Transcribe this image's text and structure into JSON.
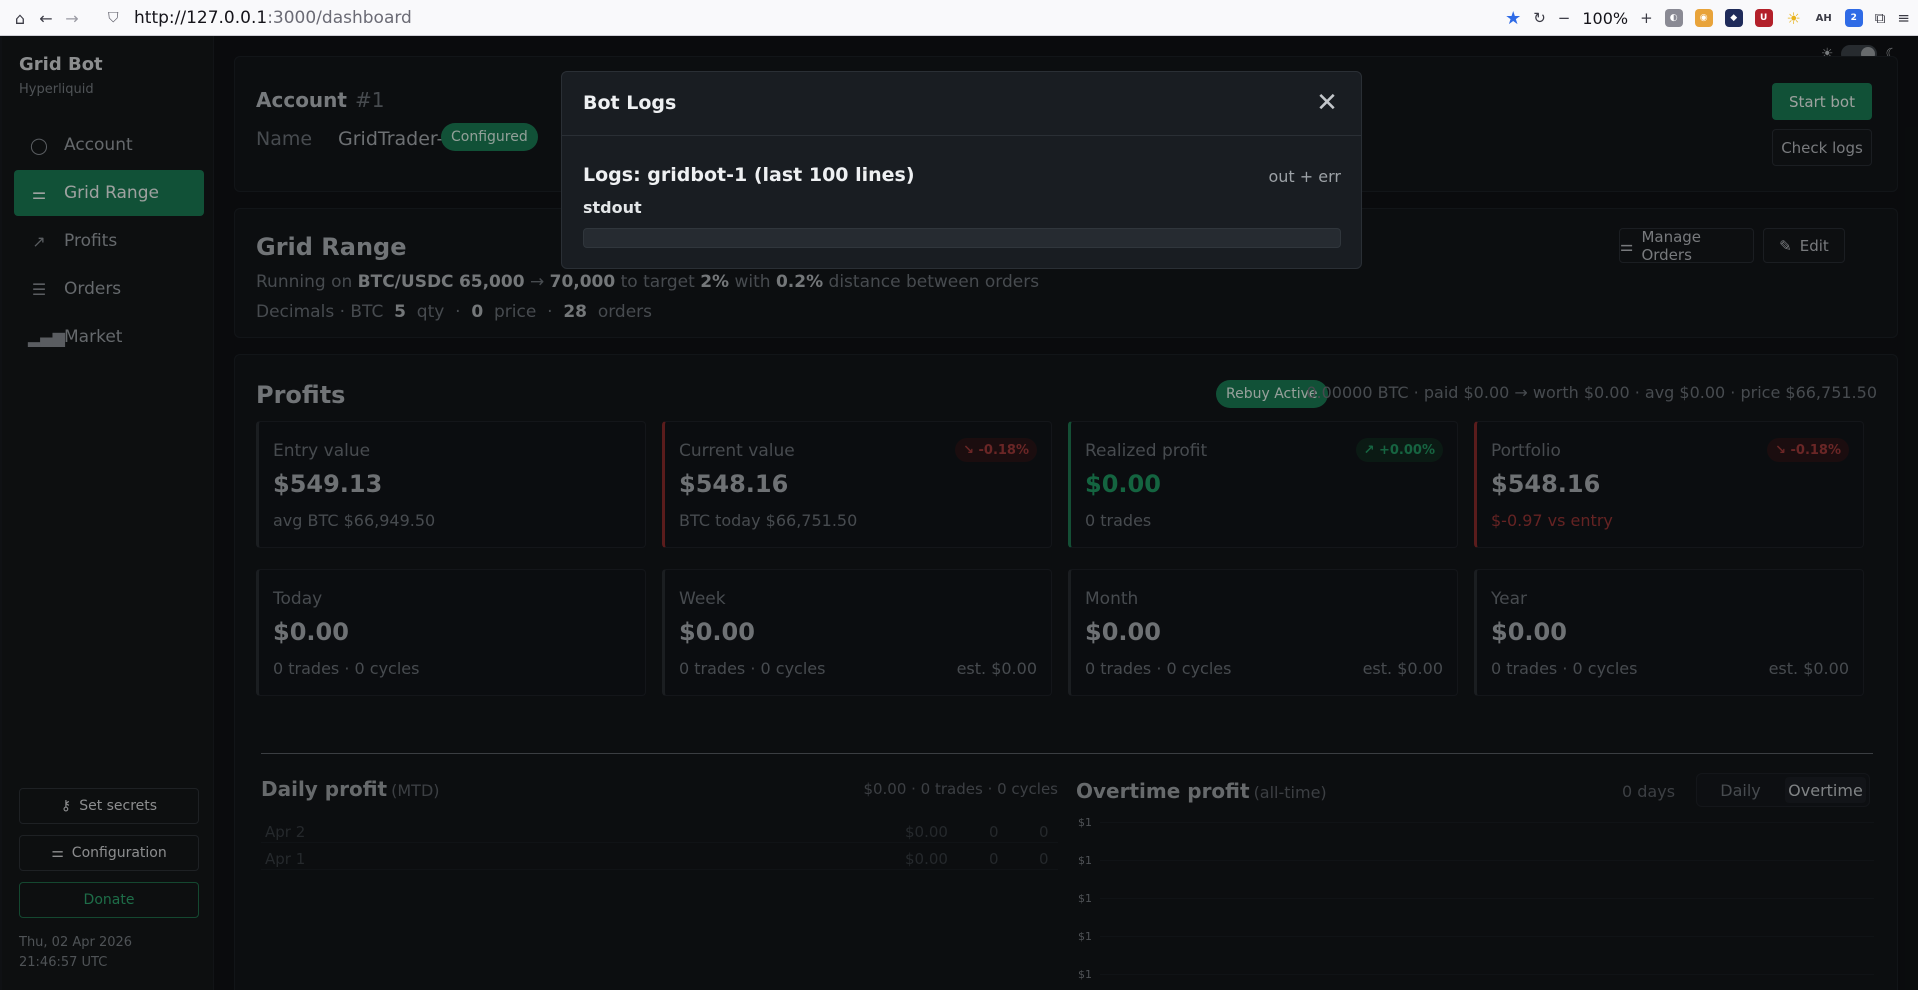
{
  "browser": {
    "url_host": "http://127.0.0.1",
    "url_rest": ":3000/dashboard",
    "zoom": "100%"
  },
  "sidebar": {
    "brand": "Grid Bot",
    "subtitle": "Hyperliquid",
    "items": [
      {
        "label": "Account",
        "icon": "user-circle-icon",
        "active": false
      },
      {
        "label": "Grid Range",
        "icon": "sliders-icon",
        "active": true
      },
      {
        "label": "Profits",
        "icon": "trend-chart-icon",
        "active": false
      },
      {
        "label": "Orders",
        "icon": "list-icon",
        "active": false
      },
      {
        "label": "Market",
        "icon": "bar-chart-icon",
        "active": false
      }
    ],
    "set_secrets": "Set secrets",
    "configuration": "Configuration",
    "donate": "Donate",
    "timestamp": "Thu, 02 Apr 2026 21:46:57 UTC"
  },
  "account": {
    "title": "Account",
    "number": "#1",
    "name_label": "Name",
    "name_value": "GridTrader-1",
    "status_badge": "Configured",
    "start_bot": "Start bot",
    "check_logs": "Check logs"
  },
  "grid_range": {
    "title": "Grid Range",
    "manage_orders": "Manage Orders",
    "edit": "Edit",
    "running_on": "Running on",
    "pair": "BTC/USDC",
    "low": "65,000",
    "arrow": "→",
    "high": "70,000",
    "to_target": "to target",
    "target": "2%",
    "with": "with",
    "distance": "0.2%",
    "distance_text": "distance between orders",
    "decimals_label": "Decimals · BTC",
    "qty": "5",
    "qty_label": "qty",
    "price": "0",
    "price_label": "price",
    "orders": "28",
    "orders_label": "orders",
    "sep": "·"
  },
  "profits": {
    "title": "Profits",
    "rebuy": "Rebuy Active",
    "summary": "0.00000 BTC · paid $0.00 → worth $0.00 · avg $0.00 · price $66,751.50",
    "cards": [
      {
        "label": "Entry value",
        "value": "$549.13",
        "sub": "avg BTC $66,949.50",
        "pill": "",
        "accent": "neutral"
      },
      {
        "label": "Current value",
        "value": "$548.16",
        "sub": "BTC today $66,751.50",
        "pill": "↘ -0.18%",
        "accent": "red"
      },
      {
        "label": "Realized profit",
        "value": "$0.00",
        "sub": "0 trades",
        "pill": "↗ +0.00%",
        "accent": "green"
      },
      {
        "label": "Portfolio",
        "value": "$548.16",
        "sub": "$-0.97 vs entry",
        "pill": "↘ -0.18%",
        "accent": "red"
      }
    ],
    "periods": [
      {
        "label": "Today",
        "value": "$0.00",
        "sub": "0 trades · 0 cycles",
        "est": ""
      },
      {
        "label": "Week",
        "value": "$0.00",
        "sub": "0 trades · 0 cycles",
        "est": "est. $0.00"
      },
      {
        "label": "Month",
        "value": "$0.00",
        "sub": "0 trades · 0 cycles",
        "est": "est. $0.00"
      },
      {
        "label": "Year",
        "value": "$0.00",
        "sub": "0 trades · 0 cycles",
        "est": "est. $0.00"
      }
    ]
  },
  "daily": {
    "title": "Daily profit",
    "qualifier": "(MTD)",
    "summary": "$0.00 · 0 trades · 0 cycles",
    "rows": [
      {
        "date": "Apr 2",
        "amount": "$0.00",
        "trades": "0",
        "cycles": "0"
      },
      {
        "date": "Apr 1",
        "amount": "$0.00",
        "trades": "0",
        "cycles": "0"
      }
    ]
  },
  "overtime": {
    "title": "Overtime profit",
    "qualifier": "(all-time)",
    "days": "0 days",
    "tab_daily": "Daily",
    "tab_overtime": "Overtime",
    "y_ticks": [
      "$1",
      "$1",
      "$1",
      "$1",
      "$1"
    ]
  },
  "modal": {
    "title": "Bot Logs",
    "logs_title": "Logs: gridbot-1 (last 100 lines)",
    "logs_meta": "out + err",
    "stdout_label": "stdout"
  },
  "colors": {
    "accent_green": "#1b7d55",
    "danger_red": "#a33b3b",
    "background": "#101214"
  }
}
